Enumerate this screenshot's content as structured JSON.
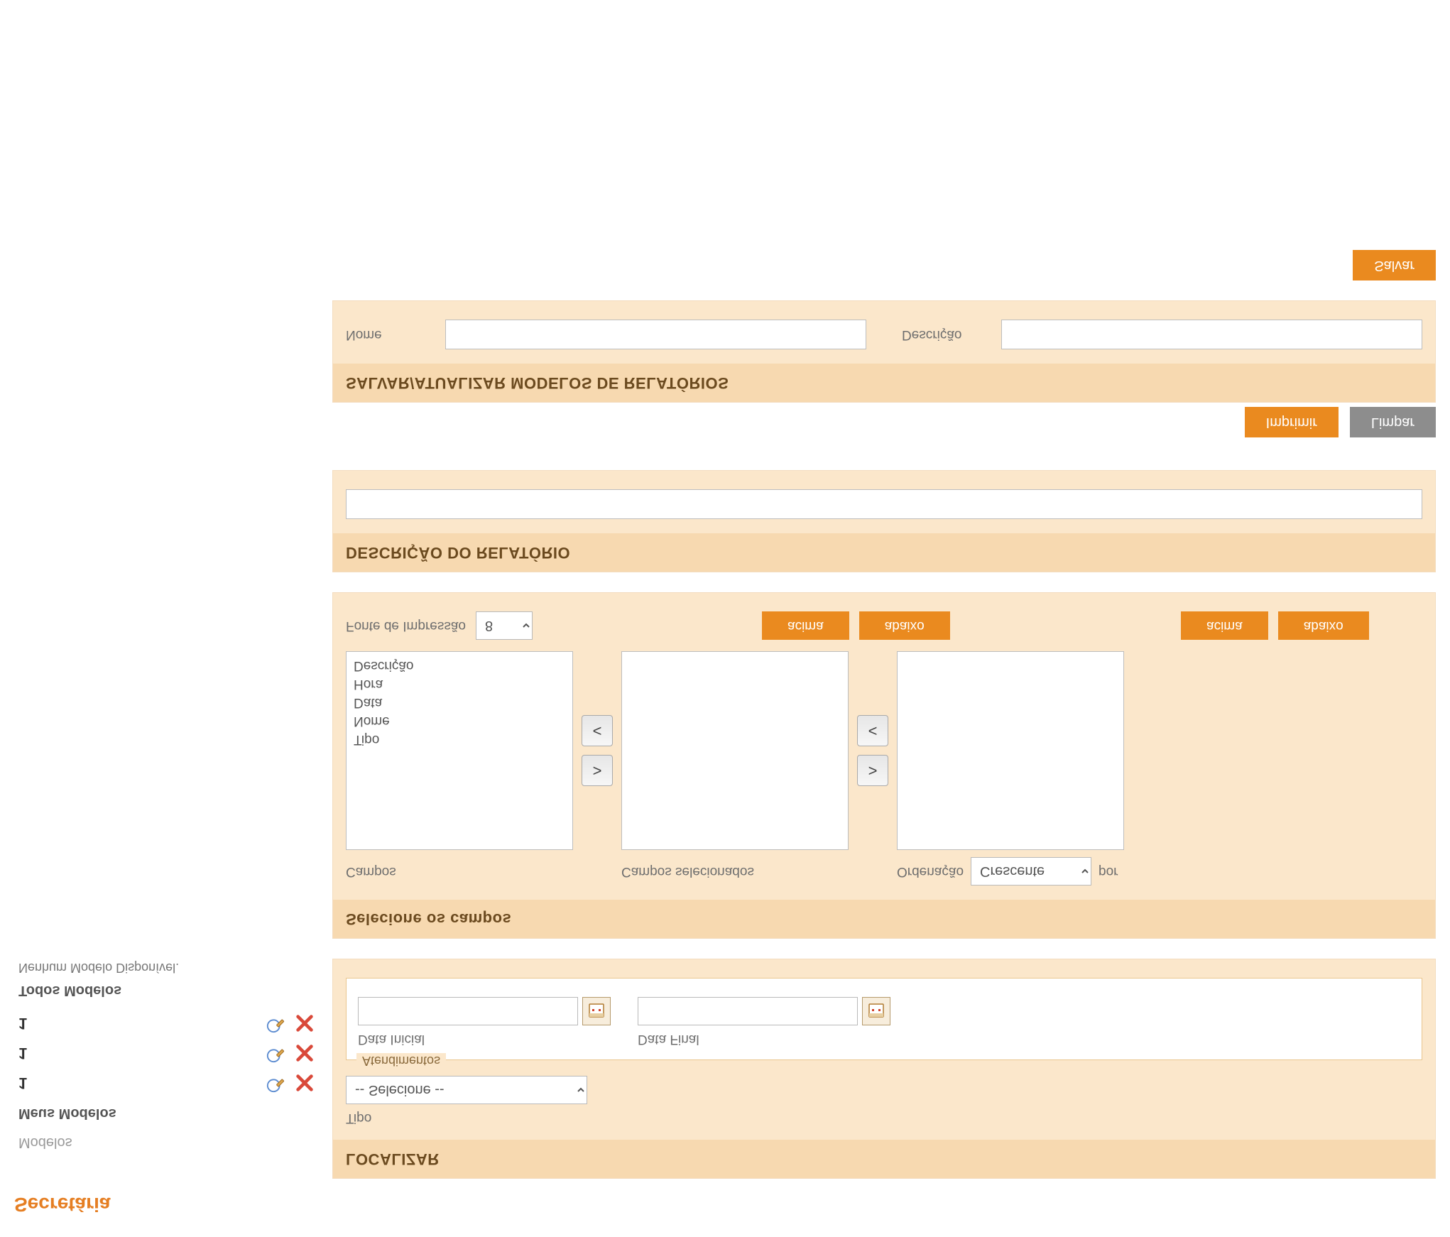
{
  "page": {
    "title": "Secretária"
  },
  "sidebar": {
    "heading": "Modelos",
    "my_models_label": "Meus Modelos",
    "all_models_label": "Todos Modelos",
    "no_model": "Nenhum Modelo Disponível.",
    "items": [
      {
        "label": "1"
      },
      {
        "label": "1"
      },
      {
        "label": "1"
      }
    ]
  },
  "localizar": {
    "header": "LOCALIZAR",
    "tipo_label": "Tipo",
    "tipo_placeholder": "-- Selecione --",
    "fieldset_title": "Atendimentos",
    "data_inicial_label": "Data Inicial",
    "data_final_label": "Data Final"
  },
  "campos": {
    "header": "Selecione os campos",
    "campos_label": "Campos",
    "selecionados_label": "Campos selecionados",
    "ordenacao_label": "Ordenação",
    "ord_select": "Crescente",
    "por_label": "por",
    "campos_list": [
      "Tipo",
      "Nome",
      "Data",
      "Hora",
      "Descrição"
    ],
    "acima": "acima",
    "abaixo": "abaixo",
    "fonte_label": "Fonte de Impressão",
    "fonte_valor": "8"
  },
  "descricao": {
    "header": "DESCRIÇÃO DO RELATÓRIO"
  },
  "actions": {
    "imprimir": "Imprimir",
    "limpar": "Limpar",
    "salvar": "Salvar"
  },
  "salvar_modelo": {
    "header": "SALVAR/ATUALIZAR MODELOS DE RELATÓRIOS",
    "nome_label": "Nome",
    "descricao_label": "Descrição"
  }
}
